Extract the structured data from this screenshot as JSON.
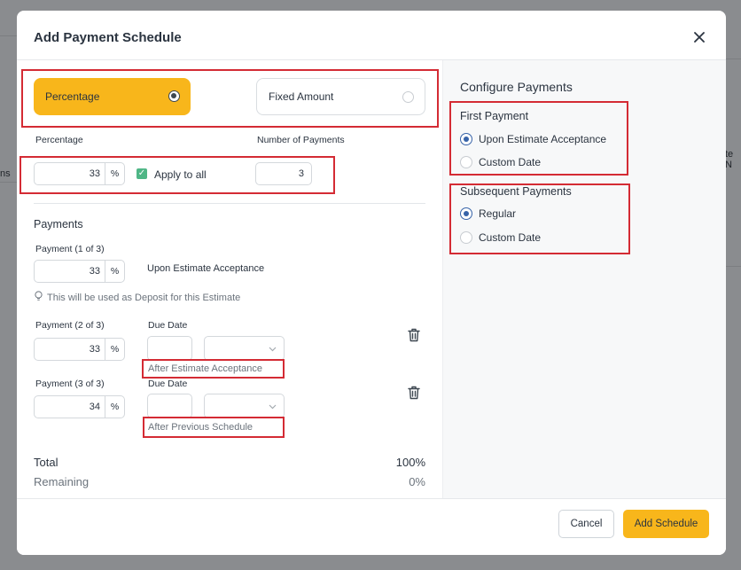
{
  "background": {
    "left_partial": "ns",
    "right_partial": "te N"
  },
  "modal": {
    "title": "Add Payment Schedule",
    "close_icon": "close-icon"
  },
  "type_selector": {
    "percentage_label": "Percentage",
    "fixed_amount_label": "Fixed Amount",
    "selected": "Percentage"
  },
  "top_fields": {
    "percentage_label": "Percentage",
    "percentage_value": "33",
    "percentage_unit": "%",
    "apply_to_all_label": "Apply to all",
    "apply_to_all_checked": true,
    "num_payments_label": "Number of Payments",
    "num_payments_value": "3"
  },
  "payments": {
    "section_title": "Payments",
    "items": [
      {
        "label": "Payment (1 of 3)",
        "value": "33",
        "unit": "%",
        "description": "Upon Estimate Acceptance",
        "hint": "This will be used as Deposit for this Estimate"
      },
      {
        "label": "Payment (2 of 3)",
        "value": "33",
        "unit": "%",
        "due_date_label": "Due Date",
        "after_text": "After Estimate Acceptance"
      },
      {
        "label": "Payment (3 of 3)",
        "value": "34",
        "unit": "%",
        "due_date_label": "Due Date",
        "after_text": "After Previous Schedule"
      }
    ]
  },
  "totals": {
    "total_label": "Total",
    "total_value": "100%",
    "remaining_label": "Remaining",
    "remaining_value": "0%"
  },
  "configure": {
    "title": "Configure Payments",
    "first_payment": {
      "title": "First Payment",
      "options": [
        "Upon Estimate Acceptance",
        "Custom Date"
      ],
      "selected": "Upon Estimate Acceptance"
    },
    "subsequent_payments": {
      "title": "Subsequent Payments",
      "options": [
        "Regular",
        "Custom Date"
      ],
      "selected": "Regular"
    }
  },
  "footer": {
    "cancel_label": "Cancel",
    "submit_label": "Add Schedule"
  },
  "colors": {
    "accent": "#f8b61b",
    "highlight_border": "#d42b34",
    "radio_selected": "#3763a8",
    "checkbox": "#4fb686"
  }
}
